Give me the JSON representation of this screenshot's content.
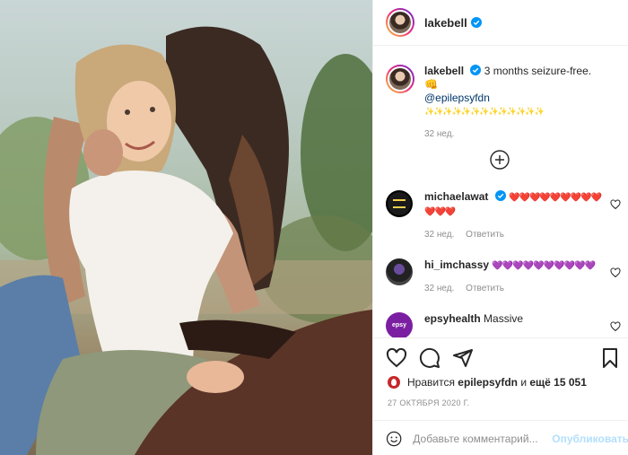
{
  "photo": {
    "alt_subject": "photo",
    "icon": "photo"
  },
  "header": {
    "username": "lakebell",
    "verified": true
  },
  "caption": {
    "username": "lakebell",
    "text": "3 months seizure-free. 👊",
    "mention": "@epilepsyfdn",
    "sparkles": "✨✨✨✨✨✨✨✨✨✨✨✨✨",
    "time": "32 нед."
  },
  "comments": [
    {
      "username": "michaelawat",
      "verified": true,
      "text": "❤️❤️❤️❤️❤️❤️❤️❤️❤️❤️❤️❤️",
      "time": "32 нед.",
      "reply": "Ответить"
    },
    {
      "username": "hi_imchassy",
      "verified": false,
      "text": "💜💜💜💜💜💜💜💜💜💜",
      "time": "32 нед.",
      "reply": "Ответить"
    },
    {
      "username": "epsyhealth",
      "verified": false,
      "text": "Massive",
      "time": "",
      "reply": ""
    }
  ],
  "actions": {
    "likes_prefix": "Нравится",
    "likes_user": "epilepsyfdn",
    "likes_middle": "и",
    "likes_count": "ещё 15 051",
    "date": "27 ОКТЯБРЯ 2020 Г."
  },
  "add_comment": {
    "placeholder": "Добавьте комментарий...",
    "publish": "Опубликовать"
  },
  "colors": {
    "link": "#00376b",
    "meta": "#8e8e8e",
    "verified": "#0095f6",
    "publish": "#b2dffc"
  }
}
